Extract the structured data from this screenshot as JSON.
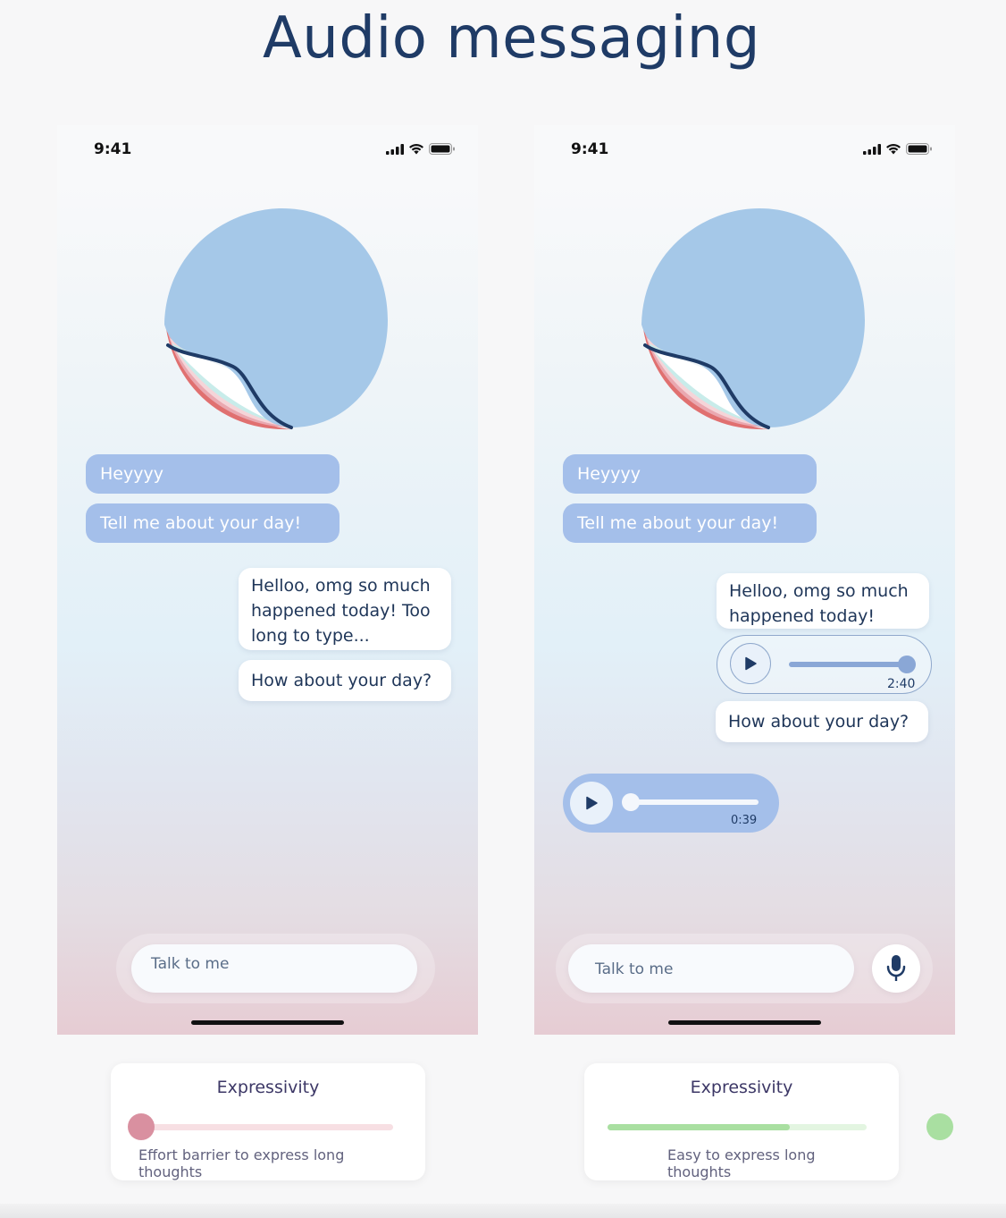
{
  "page": {
    "title": "Audio messaging"
  },
  "left_phone": {
    "status_time": "9:41",
    "messages_received": [
      "Heyyyy",
      "Tell me about your day!"
    ],
    "messages_sent": [
      "Helloo, omg so much happened today! Too long to type...",
      "How about your day?"
    ],
    "input_placeholder": "Talk to me"
  },
  "right_phone": {
    "status_time": "9:41",
    "messages_received": [
      "Heyyyy",
      "Tell me about your day!"
    ],
    "messages_sent": [
      "Helloo, omg so much happened today!",
      "How about your day?"
    ],
    "sent_audio": {
      "duration": "2:40",
      "progress": 1.0
    },
    "received_audio": {
      "duration": "0:39",
      "progress": 0.0
    },
    "input_placeholder": "Talk to me",
    "mic_icon": "microphone-icon"
  },
  "expressivity_left": {
    "title": "Expressivity",
    "caption": "Effort barrier to express long thoughts",
    "level": 0.0,
    "color": "#d990a0"
  },
  "expressivity_right": {
    "title": "Expressivity",
    "caption": "Easy to express long thoughts",
    "level": 0.75,
    "color": "#a9dfa1"
  },
  "colors": {
    "received_bubble": "#a4bfea",
    "title": "#1f3b66",
    "blob": "#a5c8e8"
  }
}
